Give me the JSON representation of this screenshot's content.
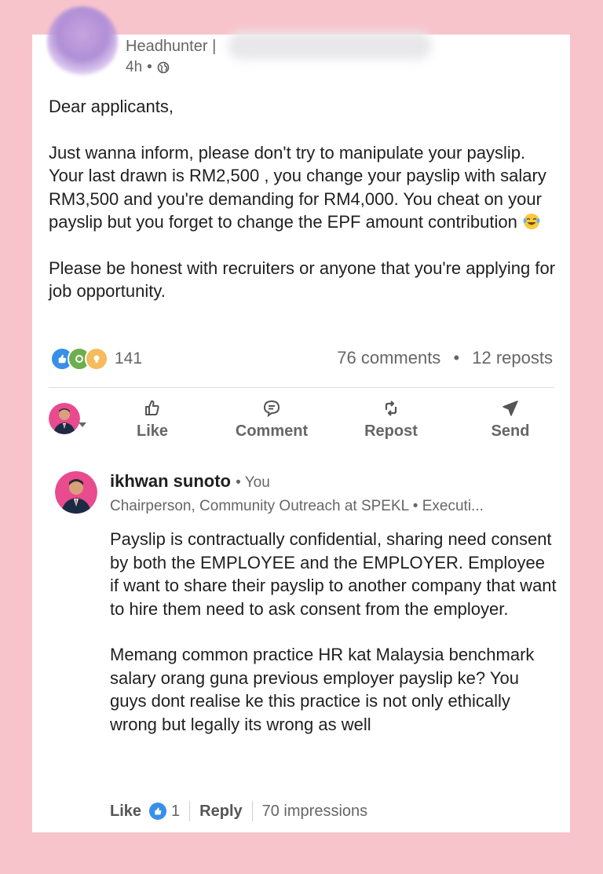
{
  "post": {
    "author_role": "Headhunter |",
    "time": "4h",
    "dot": "•",
    "paragraphs": [
      "Dear applicants,",
      "Just wanna inform, please don't try to manipulate your payslip. Your last drawn is RM2,500 , you change your payslip with salary RM3,500 and you're demanding for RM4,000. You cheat on your payslip but you forget to change the EPF amount contribution",
      "Please be honest with recruiters or anyone that you're applying for job opportunity."
    ],
    "emoji_icon": "laughing-tears-emoji"
  },
  "stats": {
    "reactions_count": "141",
    "comments": "76 comments",
    "sep": "•",
    "reposts": "12 reposts"
  },
  "actions": {
    "like": "Like",
    "comment": "Comment",
    "repost": "Repost",
    "send": "Send"
  },
  "comment": {
    "name": "ikhwan sunoto",
    "you_tag": "• You",
    "headline": "Chairperson, Community Outreach at SPEKL • Executi...",
    "paragraphs": [
      "Payslip is contractually confidential, sharing need consent by both the EMPLOYEE and the EMPLOYER. Employee if want to share their payslip to another company that want to hire them need to ask consent from the employer.",
      "Memang common practice HR kat Malaysia benchmark salary orang guna previous employer payslip ke? You guys dont realise ke this practice is not only ethically wrong but legally its wrong as well"
    ],
    "like_label": "Like",
    "like_count": "1",
    "reply_label": "Reply",
    "impressions": "70 impressions"
  },
  "colors": {
    "background": "#f8c4cc",
    "card": "#ffffff",
    "like_blue": "#378fe9",
    "celebrate_green": "#44712e",
    "insightful_yellow": "#f5bb5c"
  }
}
